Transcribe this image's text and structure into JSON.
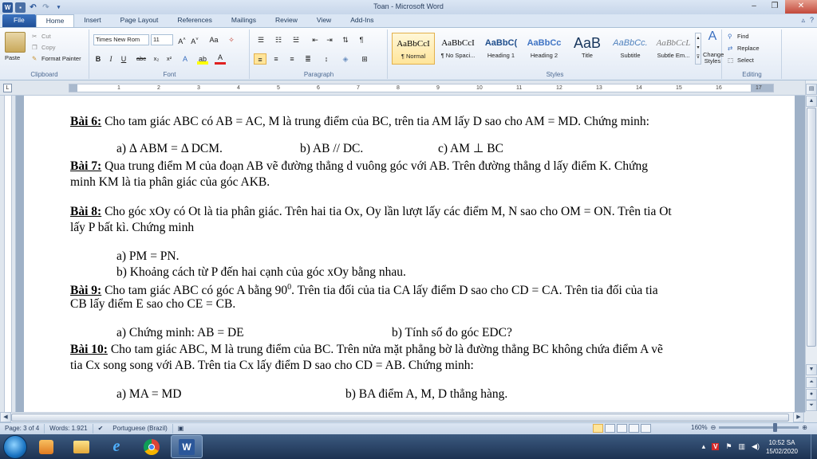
{
  "window": {
    "title": "Toan - Microsoft Word"
  },
  "tabs": [
    "File",
    "Home",
    "Insert",
    "Page Layout",
    "References",
    "Mailings",
    "Review",
    "View",
    "Add-Ins"
  ],
  "ribbon": {
    "clipboard": {
      "label": "Clipboard",
      "paste": "Paste",
      "cut": "Cut",
      "copy": "Copy",
      "format_painter": "Format Painter"
    },
    "font": {
      "label": "Font",
      "name": "Times New Rom",
      "size": "11"
    },
    "paragraph": {
      "label": "Paragraph"
    },
    "styles": {
      "label": "Styles",
      "items": [
        {
          "preview": "AaBbCcI",
          "name": "¶ Normal"
        },
        {
          "preview": "AaBbCcI",
          "name": "¶ No Spaci..."
        },
        {
          "preview": "AaBbC(",
          "name": "Heading 1"
        },
        {
          "preview": "AaBbCc",
          "name": "Heading 2"
        },
        {
          "preview": "AaB",
          "name": "Title"
        },
        {
          "preview": "AaBbCc.",
          "name": "Subtitle"
        },
        {
          "preview": "AaBbCcL",
          "name": "Subtle Em..."
        }
      ],
      "change_styles": "Change Styles"
    },
    "editing": {
      "label": "Editing",
      "find": "Find",
      "replace": "Replace",
      "select": "Select"
    }
  },
  "document": {
    "lines": [
      {
        "title": "Bài 6:",
        "text": " Cho tam giác ABC có AB = AC, M là trung điểm của BC, trên tia AM lấy D sao cho AM = MD. Chứng minh:"
      },
      {
        "text": "a)  Δ ABM =  Δ DCM."
      },
      {
        "text": "b) AB // DC."
      },
      {
        "text": "c) AM ⊥ BC"
      },
      {
        "title": "Bài 7:",
        "text": " Qua trung điểm M của đoạn AB vẽ đường thẳng d vuông góc với AB. Trên đường thẳng d lấy điểm K. Chứng"
      },
      {
        "text": "minh KM là tia phân giác của góc AKB."
      },
      {
        "title": "Bài 8:",
        "text": " Cho góc xOy có Ot là tia phân giác. Trên hai tia Ox, Oy lần lượt lấy các điểm M, N sao cho OM = ON. Trên tia Ot"
      },
      {
        "text": "lấy P bất kì. Chứng minh"
      },
      {
        "text": "a)    PM = PN."
      },
      {
        "text": "b)    Khoảng cách từ P đến hai cạnh của góc xOy bằng nhau."
      },
      {
        "title": "Bài 9:",
        "text": " Cho tam giác ABC có góc A bằng 90",
        "sup": "0",
        "tail": ". Trên tia đối của tia CA lấy điểm D sao cho CD = CA. Trên tia đối của tia"
      },
      {
        "text": "CB lấy điểm E sao cho CE = CB."
      },
      {
        "text": "a) Chứng minh: AB = DE"
      },
      {
        "text": "b) Tính số đo góc EDC?"
      },
      {
        "title": "Bài 10:",
        "text": " Cho tam giác ABC, M là trung điểm của BC. Trên nửa mặt phẳng bờ là đường thẳng BC không chứa điểm A vẽ"
      },
      {
        "text": "tia Cx song song với AB. Trên tia Cx lấy điểm D sao cho CD = AB. Chứng minh:"
      },
      {
        "text": "a) MA = MD"
      },
      {
        "text": "b) BA điểm A, M, D thẳng hàng."
      }
    ]
  },
  "status": {
    "page": "Page: 3 of 4",
    "words": "Words: 1.921",
    "language": "Portuguese (Brazil)",
    "zoom": "160%"
  },
  "taskbar": {
    "time": "10:52 SA",
    "date": "15/02/2020"
  }
}
